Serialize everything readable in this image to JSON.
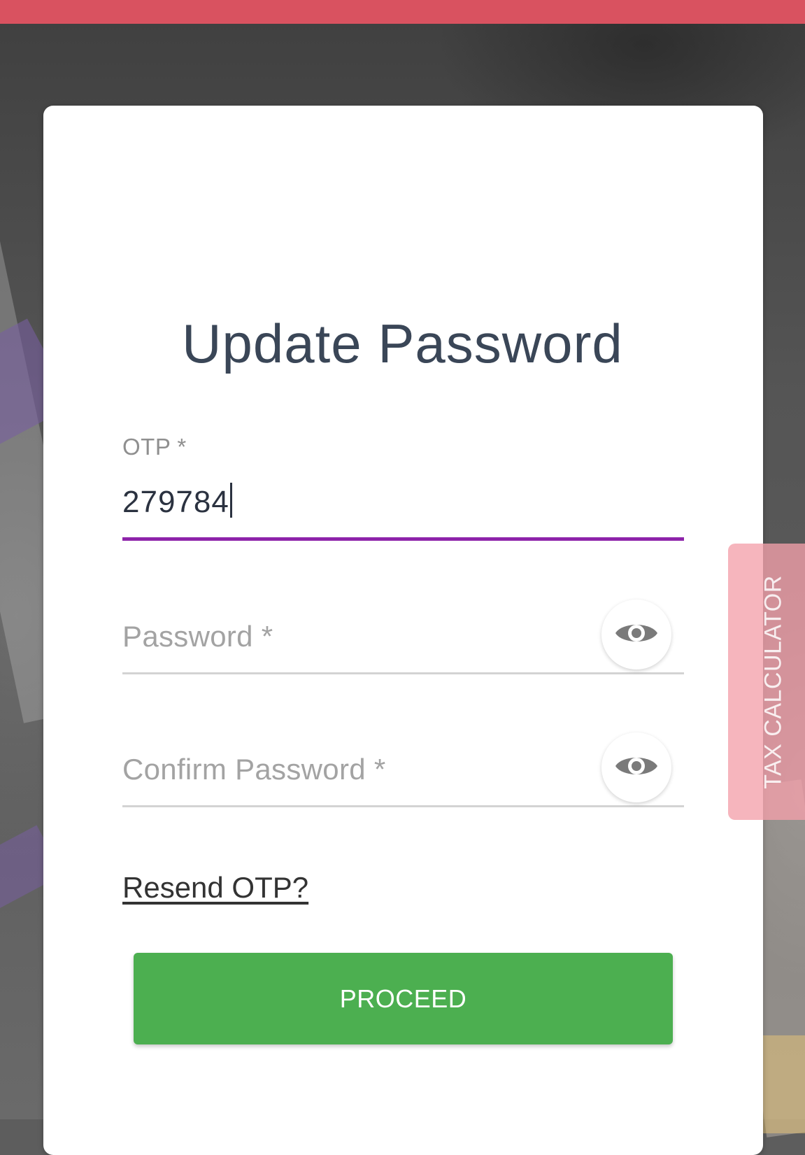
{
  "colors": {
    "top_bar": "#d95260",
    "card_background": "#ffffff",
    "title_text": "#3a4657",
    "active_underline": "#8e24aa",
    "inactive_underline": "#d3d3d3",
    "proceed_button": "#4caf50",
    "tax_tab": "#f4a0aa"
  },
  "form": {
    "title": "Update Password",
    "otp": {
      "label": "OTP *",
      "value": "279784"
    },
    "password": {
      "placeholder": "Password *",
      "toggle_icon": "eye-icon"
    },
    "confirm_password": {
      "placeholder": "Confirm Password *",
      "toggle_icon": "eye-icon"
    },
    "resend_link": "Resend OTP?",
    "proceed_label": "PROCEED"
  },
  "side_tab": {
    "label": "TAX CALCULATOR"
  }
}
